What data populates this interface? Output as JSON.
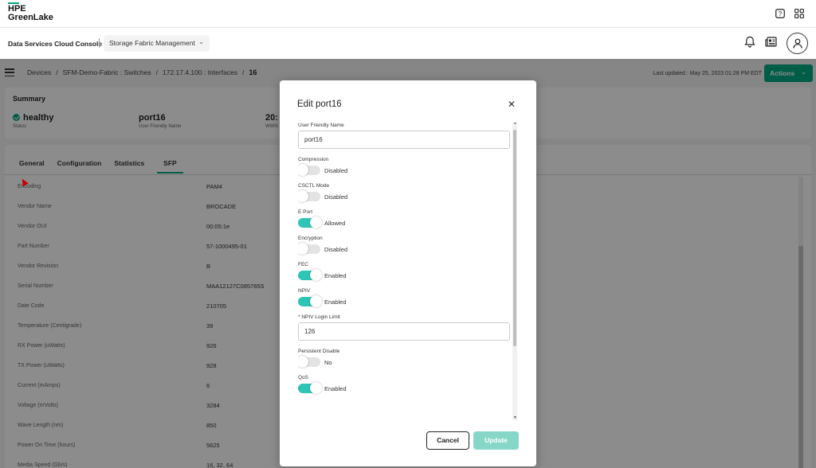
{
  "brand": {
    "line1": "HPE",
    "line2": "GreenLake",
    "accent": "#01a982"
  },
  "top_icons": [
    "help-icon",
    "apps-grid-icon"
  ],
  "console": {
    "title": "Data Services Cloud Console",
    "app_select": "Storage Fabric Management",
    "icons": [
      "bell-icon",
      "news-icon",
      "user-avatar-icon"
    ]
  },
  "breadcrumb": {
    "items": [
      "Devices",
      "SFM-Demo-Fabric : Switches",
      "172.17.4.100 : Interfaces"
    ],
    "current": "16",
    "separator": "/"
  },
  "last_updated": "Last updated : May 25, 2023 01:28 PM EDT",
  "actions_label": "Actions",
  "summary": {
    "title": "Summary",
    "status_value": "healthy",
    "status_label": "Status",
    "name_value": "port16",
    "name_label": "User Friendly Name",
    "wwn_value": "20:",
    "wwn_label": "WWN"
  },
  "tabs": [
    "General",
    "Configuration",
    "Statistics",
    "SFP"
  ],
  "active_tab": "SFP",
  "sfp_rows": [
    {
      "k": "Encoding",
      "v": "PAM4"
    },
    {
      "k": "Vendor Name",
      "v": "BROCADE"
    },
    {
      "k": "Vendor OUI",
      "v": "00:05:1e"
    },
    {
      "k": "Part Number",
      "v": "57-1000495-01"
    },
    {
      "k": "Vendor Revision",
      "v": "B"
    },
    {
      "k": "Serial Number",
      "v": "MAA12127C085765S"
    },
    {
      "k": "Date Code",
      "v": "210705"
    },
    {
      "k": "Temperature (Centigrade)",
      "v": "39"
    },
    {
      "k": "RX Power (uWatts)",
      "v": "926"
    },
    {
      "k": "TX Power (uWatts)",
      "v": "928"
    },
    {
      "k": "Current (mAmps)",
      "v": "6"
    },
    {
      "k": "Voltage (mVolts)",
      "v": "3284"
    },
    {
      "k": "Wave Length (nm)",
      "v": "850"
    },
    {
      "k": "Power On Time (hours)",
      "v": "5625"
    },
    {
      "k": "Media Speed (Gb/s)",
      "v": "16, 32, 64"
    }
  ],
  "modal": {
    "title": "Edit port16",
    "user_friendly_name_label": "User Friendly Name",
    "user_friendly_name_value": "port16",
    "toggles": [
      {
        "label": "Compression",
        "state": "Disabled",
        "on": false
      },
      {
        "label": "CSCTL Mode",
        "state": "Disabled",
        "on": false
      },
      {
        "label": "E Port",
        "state": "Allowed",
        "on": true
      },
      {
        "label": "Encryption",
        "state": "Disabled",
        "on": false
      },
      {
        "label": "FEC",
        "state": "Enabled",
        "on": true
      },
      {
        "label": "NPIV",
        "state": "Enabled",
        "on": true
      }
    ],
    "npiv_limit_label": "* NPIV Login Limit",
    "npiv_limit_value": "126",
    "toggles2": [
      {
        "label": "Persistent Disable",
        "state": "No",
        "on": false
      },
      {
        "label": "QoS",
        "state": "Enabled",
        "on": true
      }
    ],
    "cancel_label": "Cancel",
    "update_label": "Update"
  }
}
